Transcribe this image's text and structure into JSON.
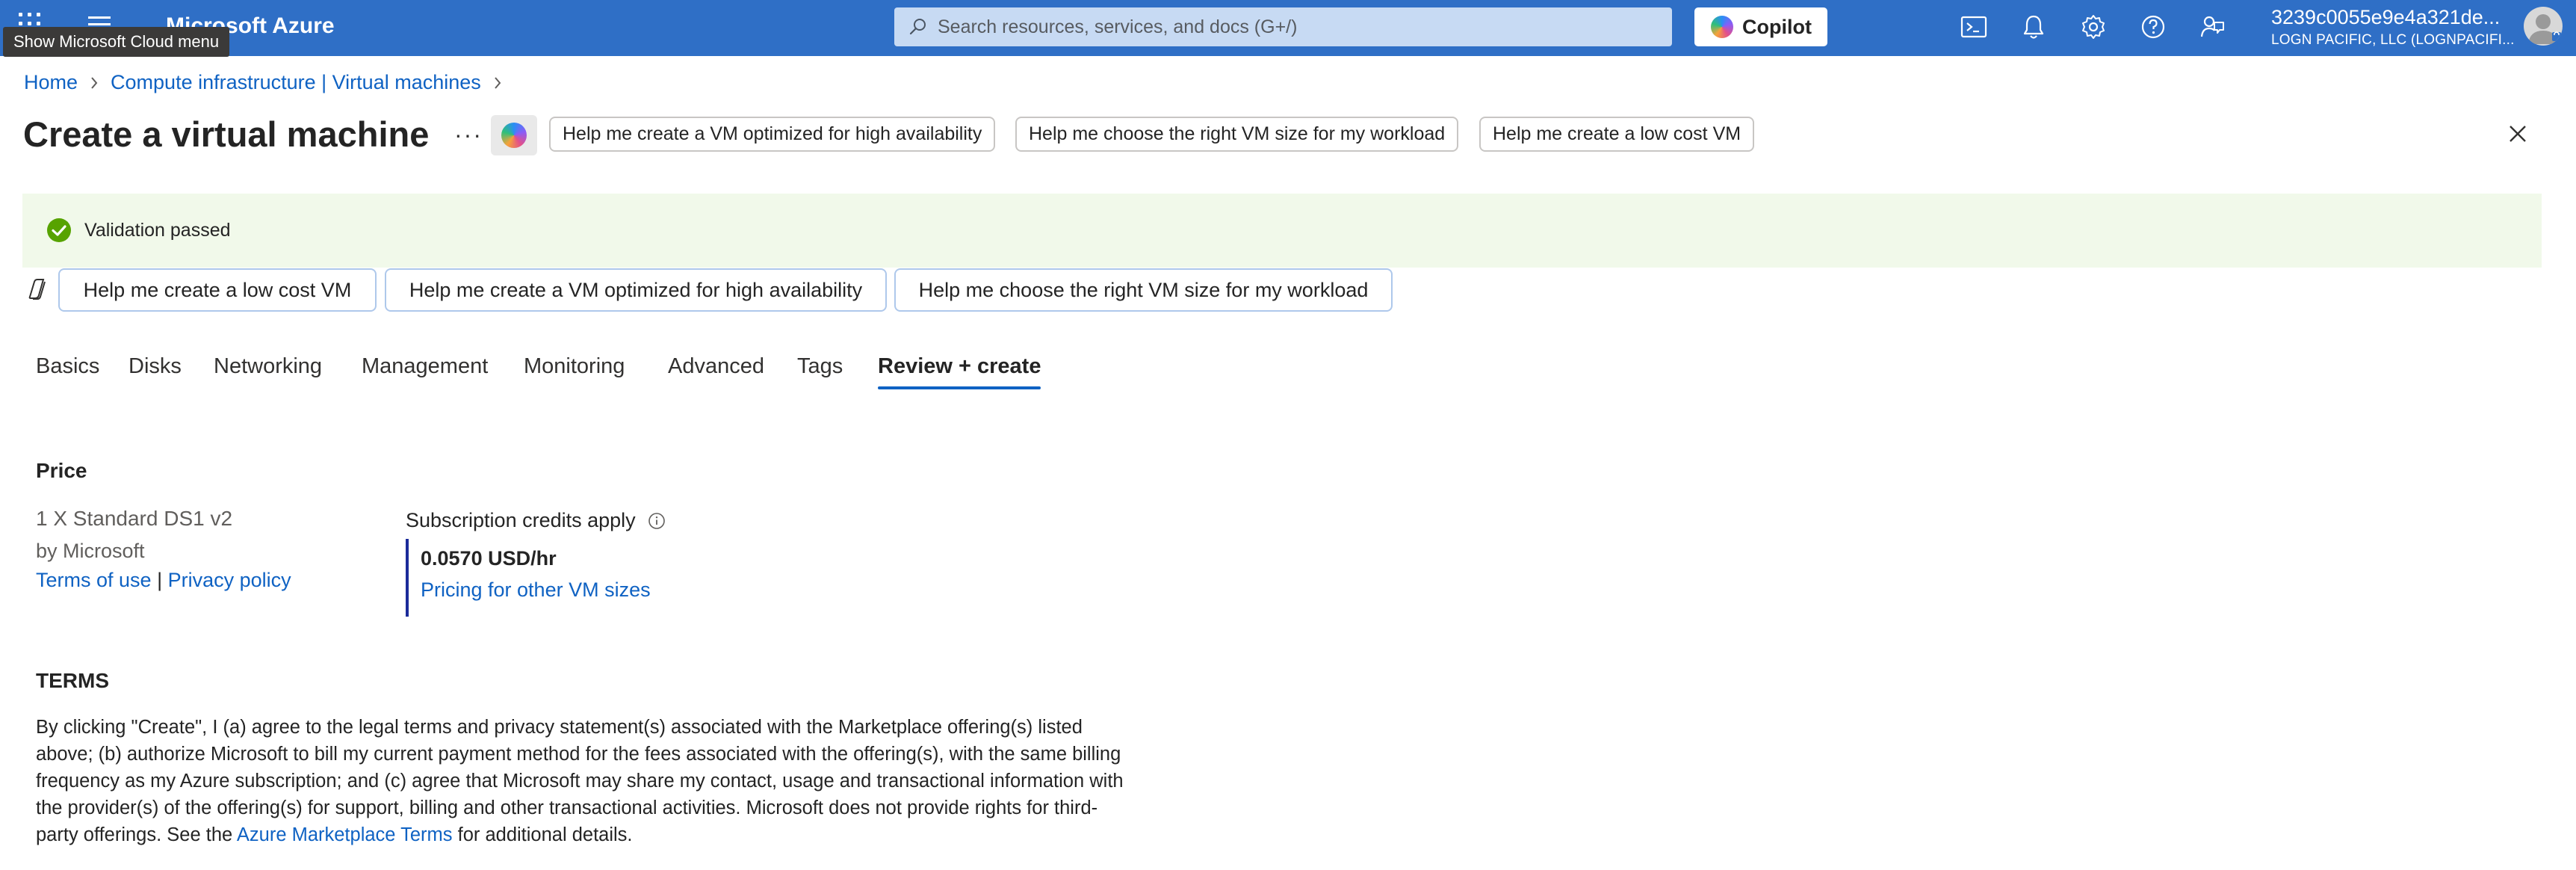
{
  "topbar": {
    "brand": "Microsoft Azure",
    "tooltip": "Show Microsoft Cloud menu",
    "search_placeholder": "Search resources, services, and docs (G+/)",
    "copilot_label": "Copilot",
    "account_name": "3239c0055e9e4a321de...",
    "account_org": "LOGN PACIFIC, LLC (LOGNPACIFI...",
    "bar_color": "#2f6fc6"
  },
  "breadcrumb": {
    "home": "Home",
    "parent": "Compute infrastructure | Virtual machines"
  },
  "header": {
    "title": "Create a virtual machine",
    "more": "···",
    "suggestions": [
      "Help me create a VM optimized for high availability",
      "Help me choose the right VM size for my workload",
      "Help me create a low cost VM"
    ]
  },
  "validation": {
    "text": "Validation passed",
    "status_color": "#57a300"
  },
  "suggestions": [
    "Help me create a low cost VM",
    "Help me create a VM optimized for high availability",
    "Help me choose the right VM size for my workload"
  ],
  "tabs": [
    "Basics",
    "Disks",
    "Networking",
    "Management",
    "Monitoring",
    "Advanced",
    "Tags",
    "Review + create"
  ],
  "active_tab": "Review + create",
  "price": {
    "heading": "Price",
    "product": "1 X Standard DS1 v2",
    "vendor": "by Microsoft",
    "terms_link": "Terms of use",
    "separator": "|",
    "privacy_link": "Privacy policy",
    "credits_label": "Subscription credits apply",
    "rate": "0.0570 USD/hr",
    "other_sizes_link": "Pricing for other VM sizes"
  },
  "terms": {
    "heading": "TERMS",
    "body_before_link": "By clicking \"Create\", I (a) agree to the legal terms and privacy statement(s) associated with the Marketplace offering(s) listed above; (b) authorize Microsoft to bill my current payment method for the fees associated with the offering(s), with the same billing frequency as my Azure subscription; and (c) agree that Microsoft may share my contact, usage and transactional information with the provider(s) of the offering(s) for support, billing and other transactional activities. Microsoft does not provide rights for third-party offerings. See the",
    "link": "Azure Marketplace Terms",
    "body_after_link": "for additional details."
  }
}
